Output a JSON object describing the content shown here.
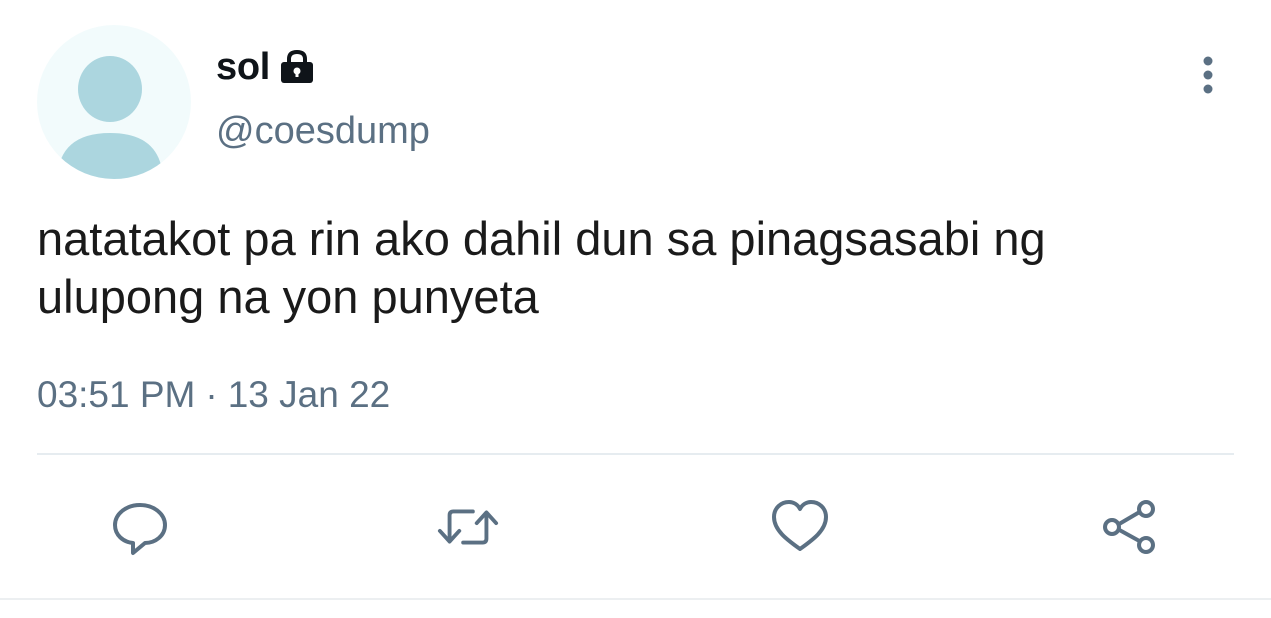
{
  "tweet": {
    "display_name": "sol",
    "handle": "@coesdump",
    "text": "natatakot pa rin ako dahil dun sa pinagsasabi ng\nulupong na yon punyeta",
    "time": "03:51 PM",
    "separator": "·",
    "date": "13 Jan 22"
  },
  "icons": {
    "protected": "lock-icon",
    "more": "vertical-dots-icon",
    "reply": "speech-bubble-icon",
    "retweet": "retweet-icon",
    "like": "heart-icon",
    "share": "share-icon"
  },
  "colors": {
    "text": "#0f1419",
    "secondary": "#5b7083",
    "avatar_bg": "#f2fbfc",
    "avatar_silhouette": "#acd6df",
    "divider": "#e6ecf0"
  }
}
